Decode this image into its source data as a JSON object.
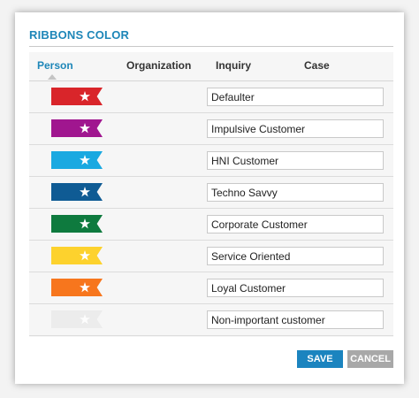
{
  "dialog": {
    "title": "RIBBONS COLOR"
  },
  "tabs": [
    {
      "label": "Person",
      "active": true
    },
    {
      "label": "Organization",
      "active": false
    },
    {
      "label": "Inquiry",
      "active": false
    },
    {
      "label": "Case",
      "active": false
    }
  ],
  "ribbons": [
    {
      "color": "#d9252a",
      "icon": "star-icon",
      "name": "Defaulter"
    },
    {
      "color": "#a0168f",
      "icon": "star-icon",
      "name": "Impulsive Customer"
    },
    {
      "color": "#1aa9e1",
      "icon": "star-icon",
      "name": "HNI Customer"
    },
    {
      "color": "#0f5b94",
      "icon": "star-icon",
      "name": "Techno Savvy"
    },
    {
      "color": "#0e7a3e",
      "icon": "star-icon",
      "name": "Corporate Customer"
    },
    {
      "color": "#fdd22d",
      "icon": "star-icon",
      "name": "Service Oriented"
    },
    {
      "color": "#f7761d",
      "icon": "star-icon",
      "name": "Loyal Customer"
    },
    {
      "color": "#ececec",
      "icon": "star-icon",
      "name": "Non-important customer"
    }
  ],
  "buttons": {
    "save_label": "SAVE",
    "cancel_label": "CANCEL"
  }
}
